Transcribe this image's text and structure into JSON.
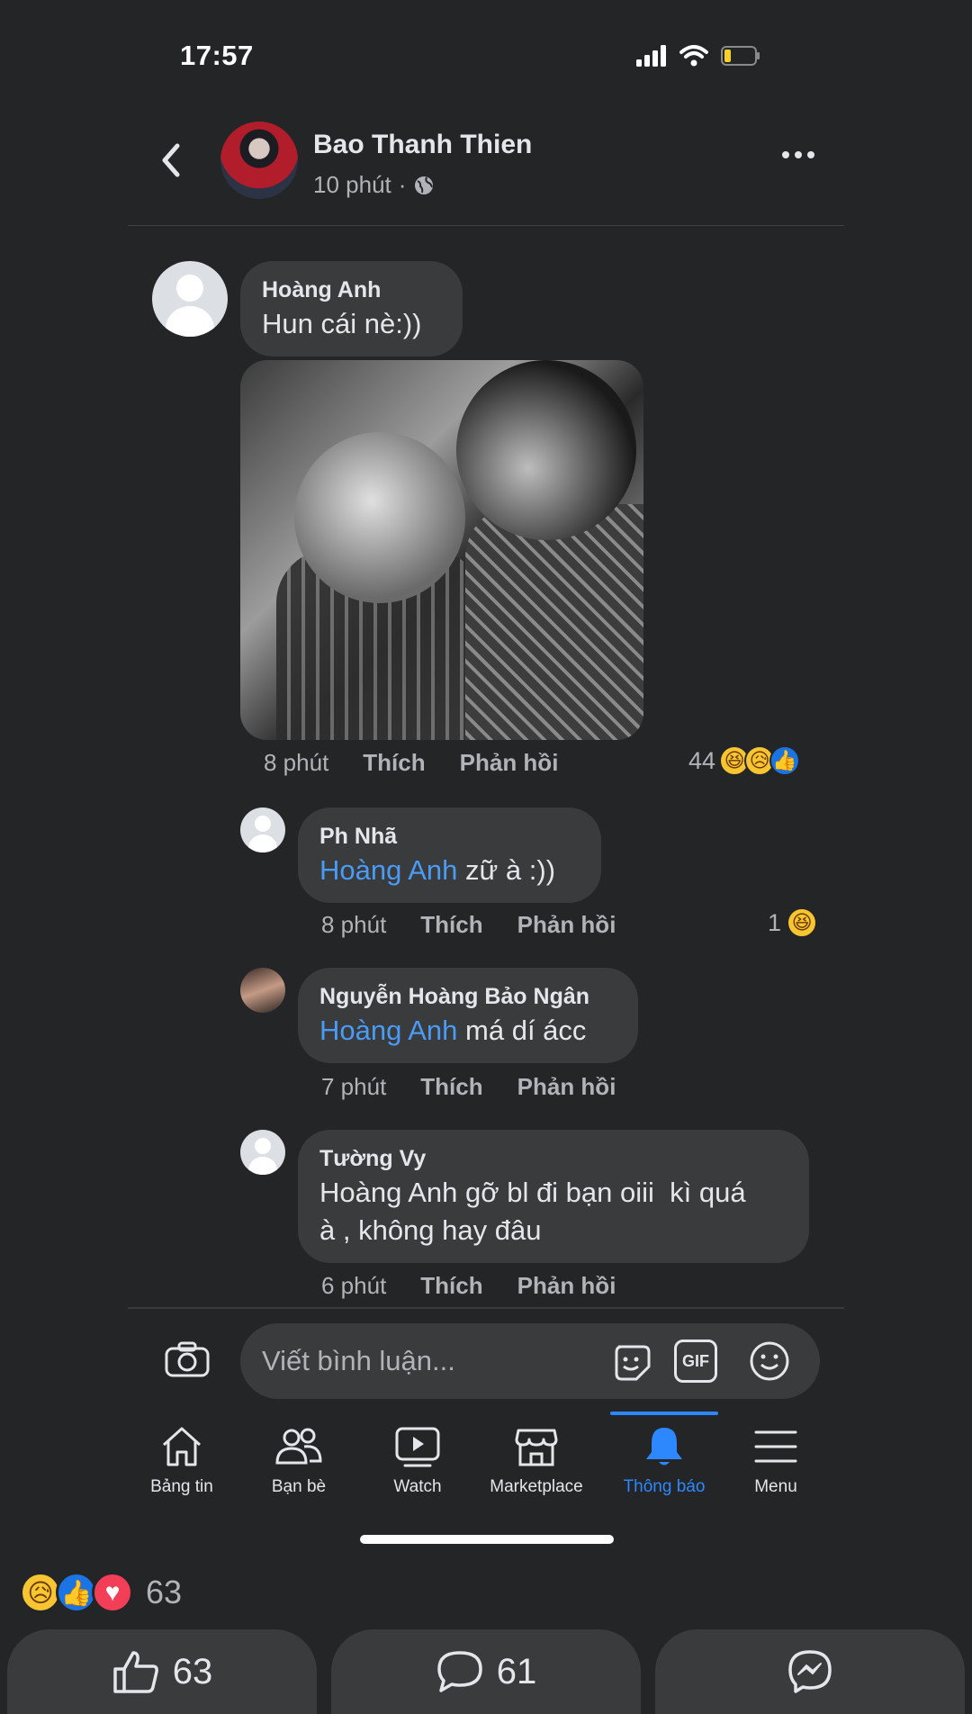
{
  "status_bar": {
    "time": "17:57"
  },
  "header": {
    "name": "Bao Thanh Thien",
    "time": "10 phút",
    "separator": "·",
    "avatar_icon": "profile-photo",
    "back_icon": "chevron-left-icon",
    "more_icon": "more-icon"
  },
  "comments": [
    {
      "name": "Hoàng Anh",
      "text": "Hun cái nè:))",
      "time": "8 phút",
      "like": "Thích",
      "reply": "Phản hồi",
      "reaction_count": "44",
      "has_photo": true
    },
    {
      "name": "Ph Nhã",
      "mention": "Hoàng Anh",
      "text": " zữ à :))",
      "time": "8 phút",
      "like": "Thích",
      "reply": "Phản hồi",
      "reaction_count": "1"
    },
    {
      "name": "Nguyễn Hoàng Bảo Ngân",
      "mention": "Hoàng Anh",
      "text": " má dí ácc",
      "time": "7 phút",
      "like": "Thích",
      "reply": "Phản hồi"
    },
    {
      "name": "Tường Vy",
      "text_line1": "Hoàng Anh gỡ bl đi bạn oiii  kì quá",
      "text_line2": "à , không hay đâu",
      "time": "6 phút",
      "like": "Thích",
      "reply": "Phản hồi"
    }
  ],
  "composer": {
    "placeholder": "Viết bình luận...",
    "gif": "GIF"
  },
  "tabs": [
    {
      "label": "Bảng tin",
      "icon": "home-icon"
    },
    {
      "label": "Bạn bè",
      "icon": "friends-icon"
    },
    {
      "label": "Watch",
      "icon": "watch-icon"
    },
    {
      "label": "Marketplace",
      "icon": "marketplace-icon"
    },
    {
      "label": "Thông báo",
      "icon": "bell-icon",
      "active": true
    },
    {
      "label": "Menu",
      "icon": "menu-icon"
    }
  ],
  "post_footer": {
    "reaction_count": "63",
    "like_count": "63",
    "comment_count": "61"
  },
  "colors": {
    "background": "#242526",
    "bubble": "#3a3b3c",
    "accent": "#2d88ff",
    "mention": "#4a9bf5"
  }
}
